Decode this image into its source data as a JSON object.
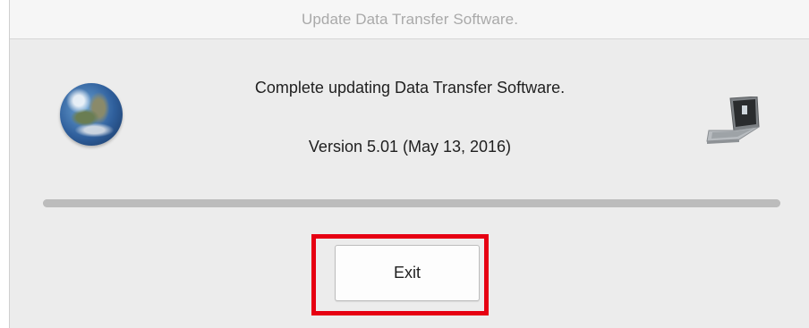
{
  "window": {
    "title": "Update Data Transfer Software."
  },
  "message": {
    "main": "Complete updating Data Transfer Software.",
    "version": "Version 5.01 (May 13, 2016)"
  },
  "icons": {
    "left": "globe-icon",
    "right": "laptop-icon"
  },
  "progress": {
    "value_percent": 100
  },
  "buttons": {
    "exit_label": "Exit"
  },
  "colors": {
    "highlight": "#e60012",
    "window_bg": "#ececec",
    "title_text": "#a9a9a9"
  }
}
